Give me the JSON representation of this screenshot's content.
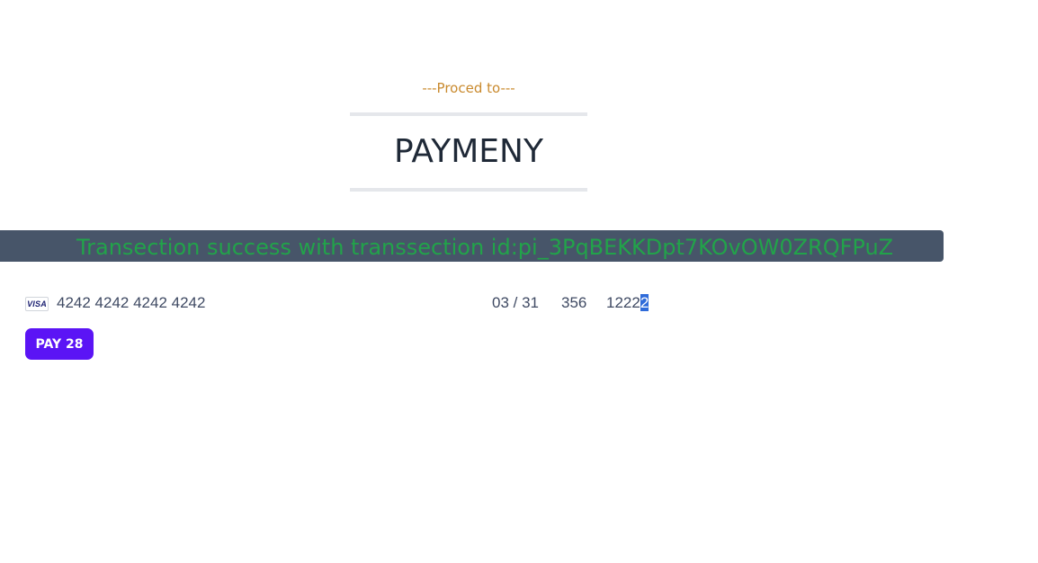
{
  "heading": {
    "subtitle": "---Proced to---",
    "title": "PAYMENY"
  },
  "banner": {
    "message": "Transection success with transsection id:pi_3PqBEKKDpt7KOvOW0ZRQFPuZ"
  },
  "card": {
    "brand": "VISA",
    "number": "4242 4242 4242 4242",
    "expiry": "03 / 31",
    "cvc": "356",
    "postal_prefix": "1222",
    "postal_selected": "2"
  },
  "pay_button": {
    "label": "PAY 28"
  },
  "colors": {
    "accent": "#5b14f5",
    "banner_bg": "#475569",
    "success_text": "#22a34a",
    "subtitle": "#c98a2e"
  }
}
